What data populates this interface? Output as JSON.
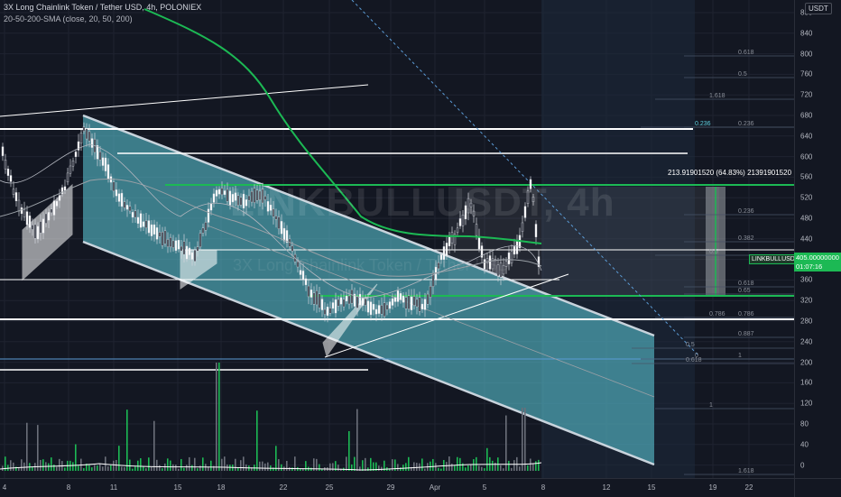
{
  "header": {
    "symbol_title": "3X Long Chainlink Token / Tether USD, 4h, POLONIEX",
    "indicator": "20-50-200-SMA (close, 20, 50, 200)"
  },
  "watermark": {
    "ticker": "LINKBULLUSDT, 4h",
    "description": "3X Long Chainlink Token / Tether USD"
  },
  "price_scale": {
    "unit": "USDT",
    "labels": [
      "880",
      "840",
      "800",
      "760",
      "720",
      "680",
      "640",
      "600",
      "560",
      "520",
      "480",
      "440",
      "400",
      "360",
      "320",
      "280",
      "240",
      "200",
      "160",
      "120",
      "80",
      "40",
      "0"
    ]
  },
  "time_scale": {
    "labels": [
      "4",
      "8",
      "11",
      "15",
      "18",
      "22",
      "25",
      "29",
      "Apr",
      "5",
      "8",
      "12",
      "15",
      "19",
      "22"
    ]
  },
  "current_price": {
    "ticker": "LINKBULLUSDT",
    "price": "405.00000000",
    "countdown": "01:07:16"
  },
  "measure": {
    "text": "213.91901520 (64.83%) 21391901520"
  },
  "fib_levels": [
    "0.618",
    "0.5",
    "1.618",
    "0.236",
    "0.236",
    "0.236",
    "0.382",
    "0.5",
    "0.618",
    "0.65",
    "0.786",
    "0.786",
    "0.887",
    "0.5",
    "0",
    "1",
    "0.618",
    "1",
    "1.618"
  ],
  "colors": {
    "background": "#131722",
    "channel_fill": "#5fd0df",
    "sma_green": "#1cb954",
    "candle_up": "#ffffff",
    "candle_down": "#3a3f4c",
    "fib_line": "#5b9bd5"
  }
}
